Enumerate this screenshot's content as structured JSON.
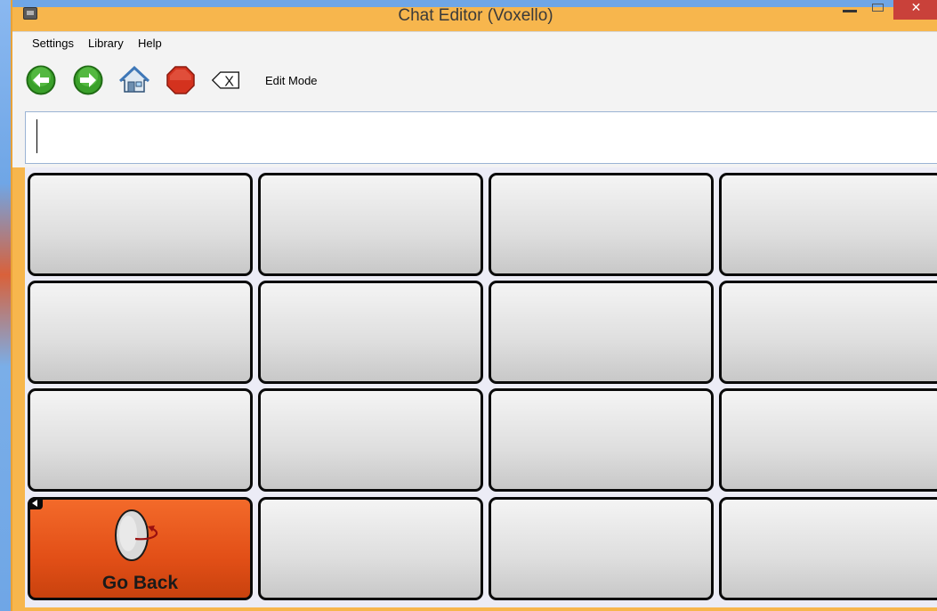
{
  "window": {
    "title": "Chat Editor (Voxello)",
    "close_glyph": "✕"
  },
  "menu": {
    "items": [
      "Settings",
      "Library",
      "Help"
    ]
  },
  "toolbar": {
    "back_icon": "back-arrow-icon",
    "forward_icon": "forward-arrow-icon",
    "home_icon": "home-icon",
    "stop_icon": "stop-icon",
    "clear_icon": "backspace-clear-icon",
    "clear_glyph": "X",
    "edit_mode_label": "Edit Mode"
  },
  "message": {
    "value": ""
  },
  "grid": {
    "rows": 4,
    "cols": 4,
    "go_back_label": "Go Back",
    "go_back_color": "#e24f17",
    "blank_cell_color": "#e0e0e0"
  },
  "colors": {
    "window_frame": "#f7b64d",
    "close_button": "#c9413a",
    "grid_background": "#ececf6"
  }
}
